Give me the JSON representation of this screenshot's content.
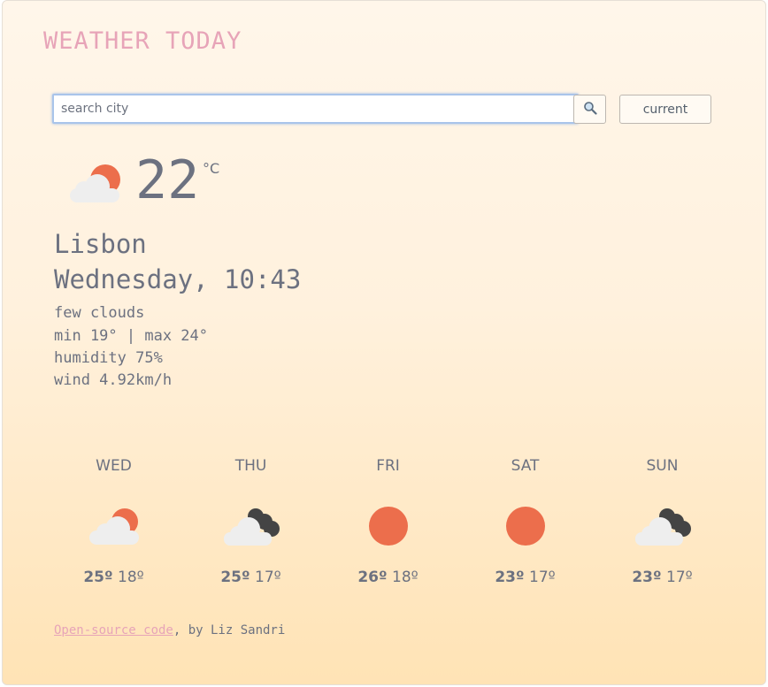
{
  "header": {
    "title": "WEATHER TODAY"
  },
  "search": {
    "placeholder": "search city",
    "value": "",
    "current_label": "current"
  },
  "colors": {
    "accent_pink": "#e7a4b8",
    "sun": "#ec6e4c",
    "text": "#6c7180"
  },
  "current": {
    "icon": "few-clouds-day-icon",
    "temperature": "22",
    "unit": "°C",
    "city": "Lisbon",
    "datetime": "Wednesday, 10:43",
    "description": "few clouds",
    "min_max": "min 19° | max 24°",
    "humidity": "humidity 75%",
    "wind": "wind 4.92km/h"
  },
  "forecast": [
    {
      "day": "WED",
      "icon": "few-clouds-day-icon",
      "max": "25º",
      "min": "18º"
    },
    {
      "day": "THU",
      "icon": "broken-clouds-icon",
      "max": "25º",
      "min": "17º"
    },
    {
      "day": "FRI",
      "icon": "clear-sun-icon",
      "max": "26º",
      "min": "18º"
    },
    {
      "day": "SAT",
      "icon": "clear-sun-icon",
      "max": "23º",
      "min": "17º"
    },
    {
      "day": "SUN",
      "icon": "broken-clouds-icon",
      "max": "23º",
      "min": "17º"
    }
  ],
  "footer": {
    "link_text": "Open-source code",
    "credit": ", by Liz Sandri"
  }
}
